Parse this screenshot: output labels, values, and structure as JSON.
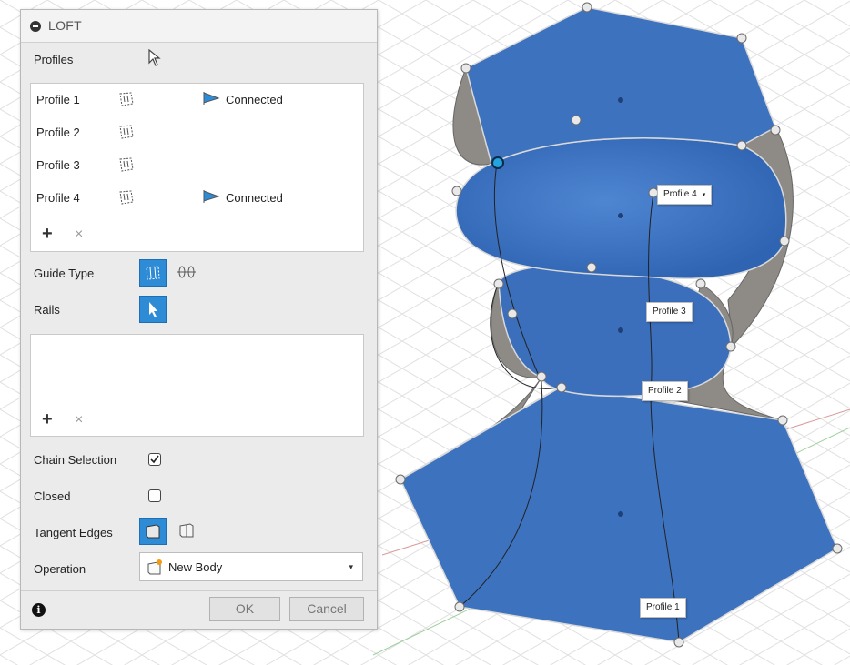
{
  "panel": {
    "title": "LOFT",
    "profiles_label": "Profiles",
    "profiles": [
      {
        "name": "Profile 1",
        "status": "Connected"
      },
      {
        "name": "Profile 2",
        "status": ""
      },
      {
        "name": "Profile 3",
        "status": ""
      },
      {
        "name": "Profile 4",
        "status": "Connected"
      }
    ],
    "add_symbol": "+",
    "remove_symbol": "×",
    "guide_type_label": "Guide Type",
    "rails_label": "Rails",
    "chain_selection_label": "Chain Selection",
    "chain_selection_checked": true,
    "closed_label": "Closed",
    "closed_checked": false,
    "tangent_edges_label": "Tangent Edges",
    "operation_label": "Operation",
    "operation_value": "New Body",
    "ok_label": "OK",
    "cancel_label": "Cancel",
    "info_symbol": "i"
  },
  "viewport": {
    "profile_labels": [
      "Profile 4",
      "Profile 3",
      "Profile 2",
      "Profile 1"
    ],
    "dropdown_symbol": "▾",
    "accent_color": "#2e8bd6",
    "body_color": "#3f74c0"
  }
}
